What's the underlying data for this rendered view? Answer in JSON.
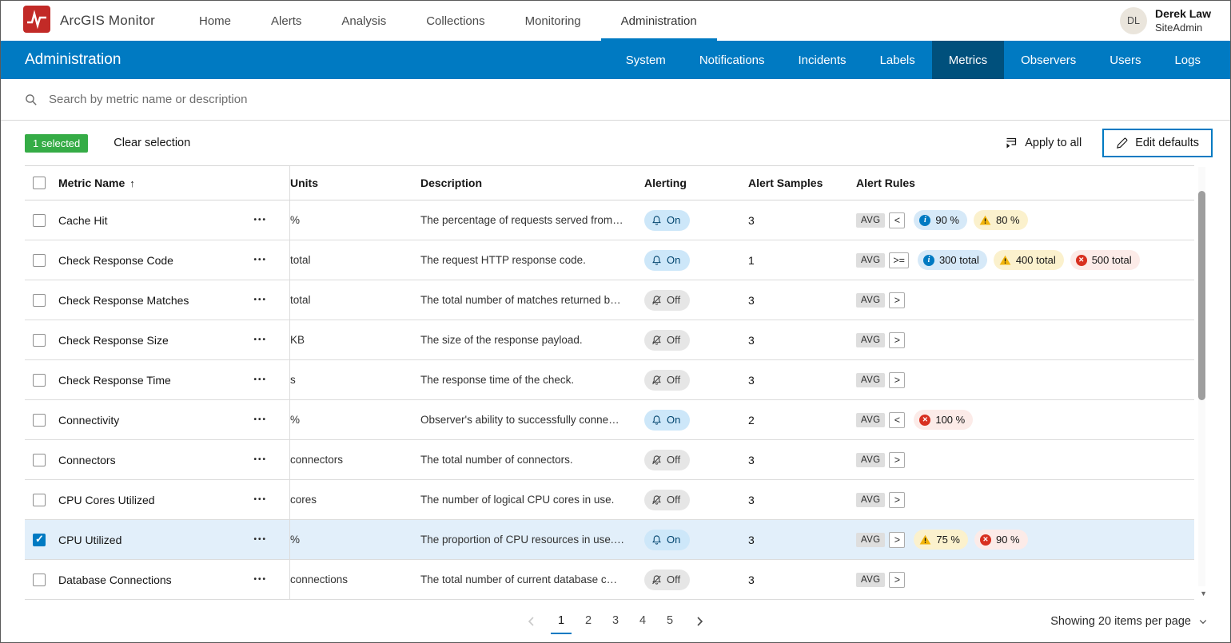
{
  "colors": {
    "brand": "#007ac2",
    "tab-active": "#00507c",
    "selected-green": "#35ac46",
    "info": "#007ac2",
    "warning": "#f2b50c",
    "error": "#d83020",
    "row-selected": "#e2effa"
  },
  "app": {
    "brand": "ArcGIS Monitor",
    "nav": [
      {
        "label": "Home",
        "active": false
      },
      {
        "label": "Alerts",
        "active": false
      },
      {
        "label": "Analysis",
        "active": false
      },
      {
        "label": "Collections",
        "active": false
      },
      {
        "label": "Monitoring",
        "active": false
      },
      {
        "label": "Administration",
        "active": true
      }
    ],
    "user": {
      "initials": "DL",
      "name": "Derek Law",
      "role": "SiteAdmin"
    }
  },
  "admin_bar": {
    "title": "Administration",
    "tabs": [
      {
        "label": "System",
        "active": false
      },
      {
        "label": "Notifications",
        "active": false
      },
      {
        "label": "Incidents",
        "active": false
      },
      {
        "label": "Labels",
        "active": false
      },
      {
        "label": "Metrics",
        "active": true
      },
      {
        "label": "Observers",
        "active": false
      },
      {
        "label": "Users",
        "active": false
      },
      {
        "label": "Logs",
        "active": false
      }
    ]
  },
  "search": {
    "placeholder": "Search by metric name or description"
  },
  "toolbar": {
    "selected_badge": "1 selected",
    "clear_selection": "Clear selection",
    "apply_to_all": "Apply to all",
    "edit_defaults": "Edit defaults"
  },
  "icons": {
    "sort-ascending-icon": "↑",
    "row-actions-icon": "•••",
    "scroll-down-icon": "▼"
  },
  "table": {
    "columns": [
      "Metric Name",
      "Units",
      "Description",
      "Alerting",
      "Alert Samples",
      "Alert Rules"
    ],
    "rows": [
      {
        "name": "Cache Hit",
        "units": "%",
        "description": "The percentage of requests served from…",
        "alerting": "On",
        "samples": "3",
        "selected": false,
        "rules": {
          "aggregation": "AVG",
          "operator": "<",
          "thresholds": [
            {
              "level": "info",
              "value": "90 %"
            },
            {
              "level": "warning",
              "value": "80 %"
            }
          ]
        }
      },
      {
        "name": "Check Response Code",
        "units": "total",
        "description": "The request HTTP response code.",
        "alerting": "On",
        "samples": "1",
        "selected": false,
        "rules": {
          "aggregation": "AVG",
          "operator": ">=",
          "thresholds": [
            {
              "level": "info",
              "value": "300 total"
            },
            {
              "level": "warning",
              "value": "400 total"
            },
            {
              "level": "error",
              "value": "500 total"
            }
          ]
        }
      },
      {
        "name": "Check Response Matches",
        "units": "total",
        "description": "The total number of matches returned b…",
        "alerting": "Off",
        "samples": "3",
        "selected": false,
        "rules": {
          "aggregation": "AVG",
          "operator": ">",
          "thresholds": []
        }
      },
      {
        "name": "Check Response Size",
        "units": "KB",
        "description": "The size of the response payload.",
        "alerting": "Off",
        "samples": "3",
        "selected": false,
        "rules": {
          "aggregation": "AVG",
          "operator": ">",
          "thresholds": []
        }
      },
      {
        "name": "Check Response Time",
        "units": "s",
        "description": "The response time of the check.",
        "alerting": "Off",
        "samples": "3",
        "selected": false,
        "rules": {
          "aggregation": "AVG",
          "operator": ">",
          "thresholds": []
        }
      },
      {
        "name": "Connectivity",
        "units": "%",
        "description": "Observer's ability to successfully conne…",
        "alerting": "On",
        "samples": "2",
        "selected": false,
        "rules": {
          "aggregation": "AVG",
          "operator": "<",
          "thresholds": [
            {
              "level": "error",
              "value": "100 %"
            }
          ]
        }
      },
      {
        "name": "Connectors",
        "units": "connectors",
        "description": "The total number of connectors.",
        "alerting": "Off",
        "samples": "3",
        "selected": false,
        "rules": {
          "aggregation": "AVG",
          "operator": ">",
          "thresholds": []
        }
      },
      {
        "name": "CPU Cores Utilized",
        "units": "cores",
        "description": "The number of logical CPU cores in use.",
        "alerting": "Off",
        "samples": "3",
        "selected": false,
        "rules": {
          "aggregation": "AVG",
          "operator": ">",
          "thresholds": []
        }
      },
      {
        "name": "CPU Utilized",
        "units": "%",
        "description": "The proportion of CPU resources in use.…",
        "alerting": "On",
        "samples": "3",
        "selected": true,
        "rules": {
          "aggregation": "AVG",
          "operator": ">",
          "thresholds": [
            {
              "level": "warning",
              "value": "75 %"
            },
            {
              "level": "error",
              "value": "90 %"
            }
          ]
        }
      },
      {
        "name": "Database Connections",
        "units": "connections",
        "description": "The total number of current database c…",
        "alerting": "Off",
        "samples": "3",
        "selected": false,
        "rules": {
          "aggregation": "AVG",
          "operator": ">",
          "thresholds": []
        }
      }
    ]
  },
  "pagination": {
    "pages": [
      "1",
      "2",
      "3",
      "4",
      "5"
    ],
    "active_page": "1",
    "items_label": "Showing 20 items per page"
  }
}
